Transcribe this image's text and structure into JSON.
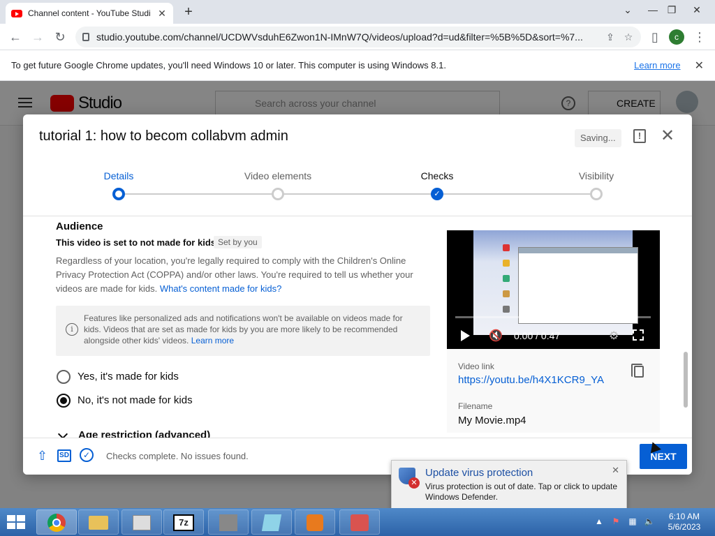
{
  "browser": {
    "tab_title": "Channel content - YouTube Studio",
    "new_tab_label": "+",
    "url": "studio.youtube.com/channel/UCDWVsduhE6Zwon1N-IMnW7Q/videos/upload?d=ud&filter=%5B%5D&sort=%7...",
    "profile_initial": "c",
    "window_buttons": [
      "⌄",
      "—",
      "❐",
      "✕"
    ]
  },
  "infobar": {
    "message": "To get future Google Chrome updates, you'll need Windows 10 or later. This computer is using Windows 8.1.",
    "link": "Learn more",
    "close": "✕"
  },
  "studio": {
    "logo": "Studio",
    "search_placeholder": "Search across your channel",
    "create_label": "CREATE"
  },
  "dialog": {
    "title": "tutorial 1: how to becom collabvm admin",
    "saving": "Saving...",
    "steps": [
      {
        "label": "Details",
        "state": "current"
      },
      {
        "label": "Video elements",
        "state": "pending"
      },
      {
        "label": "Checks",
        "state": "done"
      },
      {
        "label": "Visibility",
        "state": "pending"
      }
    ],
    "audience": {
      "title": "Audience",
      "set_text": "This video is set to not made for kids",
      "set_by": "Set by you",
      "description": "Regardless of your location, you're legally required to comply with the Children's Online Privacy Protection Act (COPPA) and/or other laws. You're required to tell us whether your videos are made for kids.",
      "description_link": "What's content made for kids?",
      "info": "Features like personalized ads and notifications won't be available on videos made for kids. Videos that are set as made for kids by you are more likely to be recommended alongside other kids' videos.",
      "info_link": "Learn more",
      "option_yes": "Yes, it's made for kids",
      "option_no": "No, it's not made for kids",
      "selected": "no",
      "age_restriction": "Age restriction (advanced)"
    },
    "video": {
      "time": "0:00 / 0:47",
      "link_label": "Video link",
      "link": "https://youtu.be/h4X1KCR9_YA",
      "filename_label": "Filename",
      "filename": "My Movie.mp4"
    },
    "footer": {
      "sd_badge": "SD",
      "status": "Checks complete. No issues found.",
      "next": "NEXT"
    }
  },
  "toast": {
    "title": "Update virus protection",
    "body": "Virus protection is out of date. Tap or click to update Windows Defender."
  },
  "taskbar": {
    "time": "6:10 AM",
    "date": "5/6/2023"
  },
  "colors": {
    "accent": "#065fd4",
    "brand_red": "#ff0000",
    "taskbar": "#2c62a7"
  }
}
